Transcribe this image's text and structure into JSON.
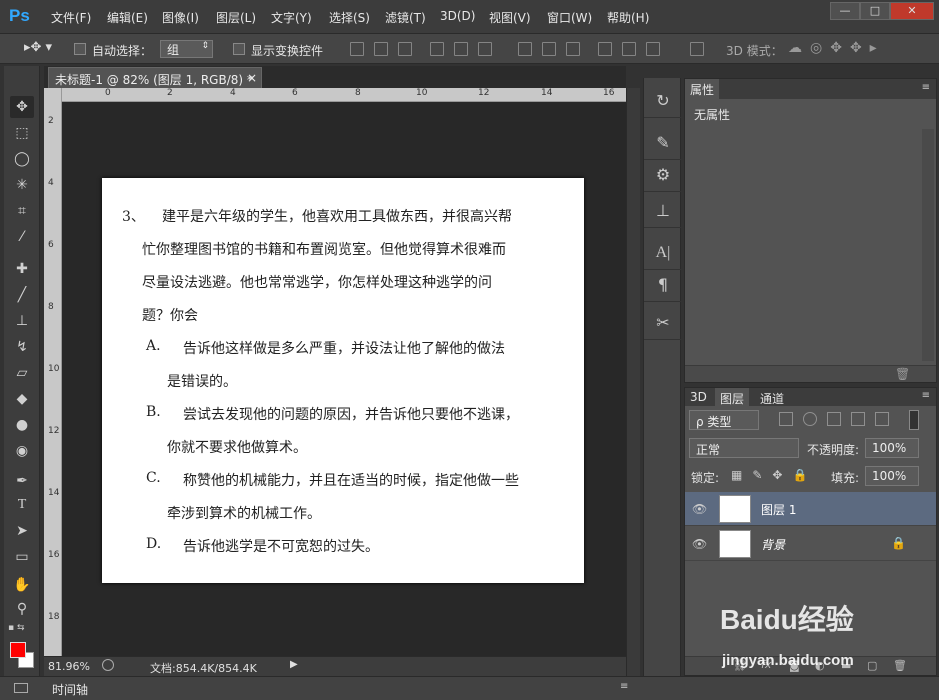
{
  "app": {
    "logo": "Ps"
  },
  "menu": [
    "文件(F)",
    "编辑(E)",
    "图像(I)",
    "图层(L)",
    "文字(Y)",
    "选择(S)",
    "滤镜(T)",
    "3D(D)",
    "视图(V)",
    "窗口(W)",
    "帮助(H)"
  ],
  "window_buttons": [
    "—",
    "□",
    "✕"
  ],
  "options": {
    "auto_select_label": "自动选择：",
    "auto_select_value": "组",
    "show_transform_label": "显示变换控件",
    "mode_3d_label": "3D 模式："
  },
  "document_tab": {
    "title": "未标题-1 @ 82% (图层 1, RGB/8) *",
    "close": "×"
  },
  "ruler_h": [
    "0",
    "2",
    "4",
    "6",
    "8",
    "10",
    "12",
    "14",
    "16"
  ],
  "ruler_v": [
    "2",
    "4",
    "6",
    "8",
    "10",
    "12",
    "14",
    "16",
    "18"
  ],
  "doc_text": {
    "q_num": "3、",
    "q_line1": "建平是六年级的学生，他喜欢用工具做东西，并很高兴帮",
    "q_line2": "忙你整理图书馆的书籍和布置阅览室。但他觉得算术很难而",
    "q_line3": "尽量设法逃避。他也常常逃学，你怎样处理这种逃学的问",
    "q_line4": "题？你会",
    "a_label": "A.",
    "a_line1": "告诉他这样做是多么严重，并设法让他了解他的做法",
    "a_line2": "是错误的。",
    "b_label": "B.",
    "b_line1": "尝试去发现他的问题的原因，并告诉他只要他不逃课，",
    "b_line2": "你就不要求他做算术。",
    "c_label": "C.",
    "c_line1": "称赞他的机械能力，并且在适当的时候，指定他做一些",
    "c_line2": "牵涉到算术的机械工作。",
    "d_label": "D.",
    "d_line1": "告诉他逃学是不可宽恕的过失。"
  },
  "status": {
    "zoom": "81.96%",
    "doc_info": "文档:854.4K/854.4K"
  },
  "timeline": {
    "label": "时间轴"
  },
  "properties": {
    "tab": "属性",
    "content": "无属性"
  },
  "layers_panel": {
    "tabs": [
      "3D",
      "图层",
      "通道"
    ],
    "filter": "ρ 类型",
    "blend_mode": "正常",
    "opacity_label": "不透明度:",
    "opacity_value": "100%",
    "lock_label": "锁定:",
    "fill_label": "填充:",
    "fill_value": "100%",
    "layers": [
      {
        "name": "图层 1",
        "selected": true
      },
      {
        "name": "背景",
        "selected": false
      }
    ]
  },
  "watermark": {
    "brand": "Baidu经验",
    "url": "jingyan.baidu.com"
  },
  "colors": {
    "foreground": "#ff0000",
    "background": "#ffffff",
    "accent": "#31a8ff",
    "selected_layer": "#5c6a80"
  }
}
